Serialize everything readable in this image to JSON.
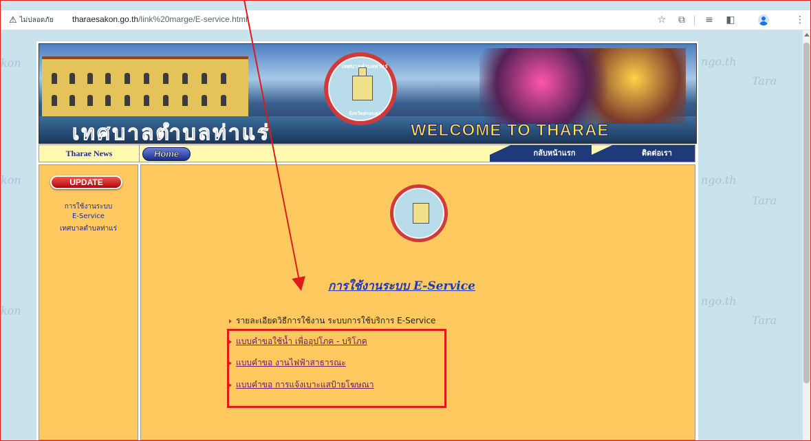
{
  "browser": {
    "security_label": "ไม่ปลอดภัย",
    "url_host": "tharaesakon.go.th",
    "url_path": "/link%20marge/E-service.html",
    "icons": [
      "warning-icon",
      "star-icon",
      "extension-icon",
      "media-icon",
      "sidepanel-icon",
      "profile-icon",
      "menu-icon"
    ]
  },
  "watermark": {
    "texts": [
      "kon",
      "ngo.th",
      "Tara"
    ]
  },
  "banner": {
    "title_th": "เทศบาลตำบลท่าแร่",
    "title_en": "WELCOME TO THARAE",
    "seal_top": "เทศบาลตำบลท่าแร่",
    "seal_bottom": "จังหวัดสกลนคร"
  },
  "nav": {
    "news": "Tharae News",
    "home": "Home",
    "tabs": [
      "กลับหน้าแรก",
      "ติดต่อเรา"
    ]
  },
  "side": {
    "update": "UPDATE",
    "links": [
      "การใช้งานระบบ",
      "E-Service",
      "เทศบาลตำบลท่าแร่"
    ]
  },
  "main": {
    "heading": "การใช้งานระบบ E-Service",
    "intro": "รายละเอียดวิธีการใช้งาน ระบบการใช้บริการ E-Service",
    "links": [
      "แบบคำขอใช้น้ำ เพื่ออุปโภค - บริโภค",
      "แบบคำขอ งานไฟฟ้าสาธารณะ",
      "แบบคำขอ การแจ้งเบาะแสป้ายโฆษณา"
    ]
  },
  "colors": {
    "annotation": "#e01a1a",
    "page_bg": "#ffc95f",
    "link": "#6a1a6a",
    "heading": "#2239b5"
  }
}
